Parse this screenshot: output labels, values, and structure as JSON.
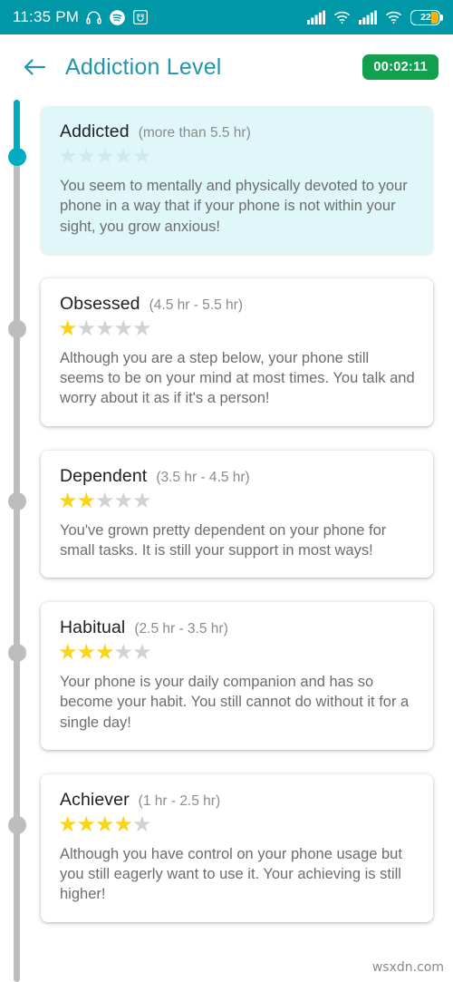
{
  "status_bar": {
    "clock": "11:35 PM",
    "left_icons": [
      "headphones-icon",
      "spotify-icon",
      "app-badge-icon"
    ],
    "right_icons": [
      "signal-bars-icon",
      "wifi-icon",
      "signal-bars-2-icon",
      "wifi-2-icon"
    ],
    "battery_percent": "22",
    "background_color": "#0097a7"
  },
  "app_bar": {
    "back_icon": "back-arrow-icon",
    "title": "Addiction Level",
    "title_color": "#2196ae",
    "timer": "00:02:11",
    "timer_color": "#11a04e"
  },
  "timeline": {
    "active_color": "#00acc1",
    "inactive_color": "#bdbdbd",
    "active_index": 0,
    "dot_count": 5
  },
  "levels": [
    {
      "title": "Addicted",
      "range": "(more than 5.5 hr)",
      "stars_filled": 0,
      "stars_total": 5,
      "description": "You seem to mentally and physically devoted to your phone in a way that if your phone is not within your sight, you grow anxious!",
      "highlighted": true
    },
    {
      "title": "Obsessed",
      "range": "(4.5 hr - 5.5 hr)",
      "stars_filled": 1,
      "stars_total": 5,
      "description": "Although you are a step below, your phone still seems to be on your mind at most times. You talk and worry about it as if it's a person!",
      "highlighted": false
    },
    {
      "title": "Dependent",
      "range": "(3.5 hr - 4.5 hr)",
      "stars_filled": 2,
      "stars_total": 5,
      "description": "You've grown pretty dependent on your phone for small tasks. It is still your support in most ways!",
      "highlighted": false
    },
    {
      "title": "Habitual",
      "range": "(2.5 hr - 3.5 hr)",
      "stars_filled": 3,
      "stars_total": 5,
      "description": "Your phone is your daily companion and has so become your habit. You still cannot do without it for a single day!",
      "highlighted": false
    },
    {
      "title": "Achiever",
      "range": "(1 hr - 2.5 hr)",
      "stars_filled": 4,
      "stars_total": 5,
      "description": "Although you have control on your phone usage but you still eagerly want to use it. Your achieving is still higher!",
      "highlighted": false
    }
  ],
  "watermark": "wsxdn.com",
  "colors": {
    "star_on": "#fbd317",
    "star_off": "#d2d2d2",
    "card_highlight_bg": "#e0f7fa"
  }
}
